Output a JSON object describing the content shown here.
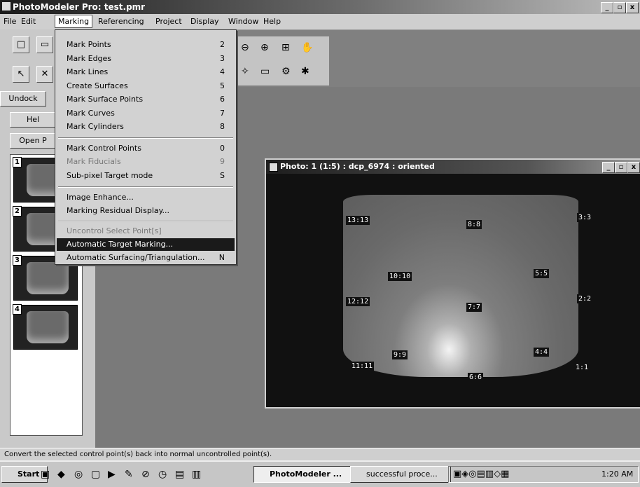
{
  "app_title": "PhotoModeler Pro: test.pmr",
  "menubar": [
    "File",
    "Edit",
    "Marking",
    "Referencing",
    "Project",
    "Display",
    "Window",
    "Help"
  ],
  "window_buttons": {
    "min": "_",
    "max": "▫",
    "close": "x"
  },
  "left_panel": {
    "undock_label": "Undock",
    "help_label": "Hel",
    "open_label": "Open P",
    "thumbs": [
      "1",
      "2",
      "3",
      "4"
    ]
  },
  "marking_menu": [
    {
      "label": "Mark Points",
      "key": "2",
      "disabled": false
    },
    {
      "label": "Mark Edges",
      "key": "3",
      "disabled": false
    },
    {
      "label": "Mark Lines",
      "key": "4",
      "disabled": false
    },
    {
      "label": "Create Surfaces",
      "key": "5",
      "disabled": false
    },
    {
      "label": "Mark Surface Points",
      "key": "6",
      "disabled": false
    },
    {
      "label": "Mark Curves",
      "key": "7",
      "disabled": false
    },
    {
      "label": "Mark Cylinders",
      "key": "8",
      "disabled": false
    },
    {
      "label": "Mark Control Points",
      "key": "0",
      "disabled": false
    },
    {
      "label": "Mark Fiducials",
      "key": "9",
      "disabled": true
    },
    {
      "label": "Sub-pixel Target mode",
      "key": "S",
      "disabled": false
    },
    {
      "label": "Image Enhance...",
      "key": "",
      "disabled": false
    },
    {
      "label": "Marking Residual Display...",
      "key": "",
      "disabled": false
    },
    {
      "label": "Uncontrol Select Point[s]",
      "key": "",
      "disabled": true
    },
    {
      "label": "Automatic Target Marking...",
      "key": "",
      "disabled": false,
      "selected": true
    },
    {
      "label": "Automatic Surfacing/Triangulation...",
      "key": "N",
      "disabled": false
    }
  ],
  "photo_window": {
    "title": "Photo: 1 (1:5) : dcp_6974 : oriented",
    "point_labels": [
      "13:13",
      "8:8",
      "3:3",
      "10:10",
      "5:5",
      "12:12",
      "7:7",
      "2:2",
      "9:9",
      "4:4",
      "11:11",
      "1:1",
      "6:6"
    ]
  },
  "status_text": "Convert the selected control point(s) back into normal uncontrolled point(s).",
  "taskbar": {
    "start": "Start",
    "tasks": [
      "PhotoModeler ...",
      "successful proce..."
    ],
    "time": "1:20 AM"
  }
}
